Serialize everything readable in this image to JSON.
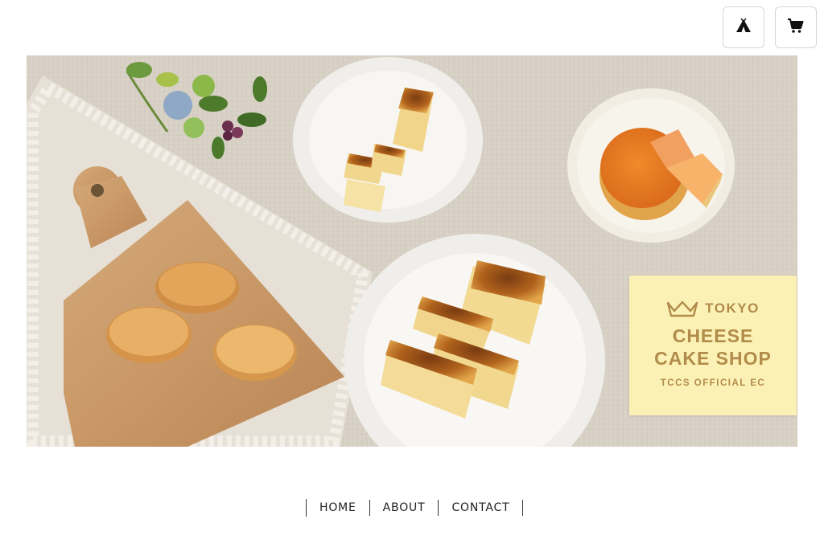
{
  "header": {
    "camp_icon": "tent-icon",
    "cart_icon": "cart-icon"
  },
  "hero": {
    "logo": {
      "line_tokyo": "TOKYO",
      "line_cheese": "CHEESE",
      "line_cake_shop": "CAKE SHOP",
      "tagline": "TCCS OFFICIAL EC",
      "color": "#b18b4a",
      "background": "#fbf1b4"
    }
  },
  "nav": {
    "items": [
      {
        "label": "HOME"
      },
      {
        "label": "ABOUT"
      },
      {
        "label": "CONTACT"
      }
    ]
  }
}
